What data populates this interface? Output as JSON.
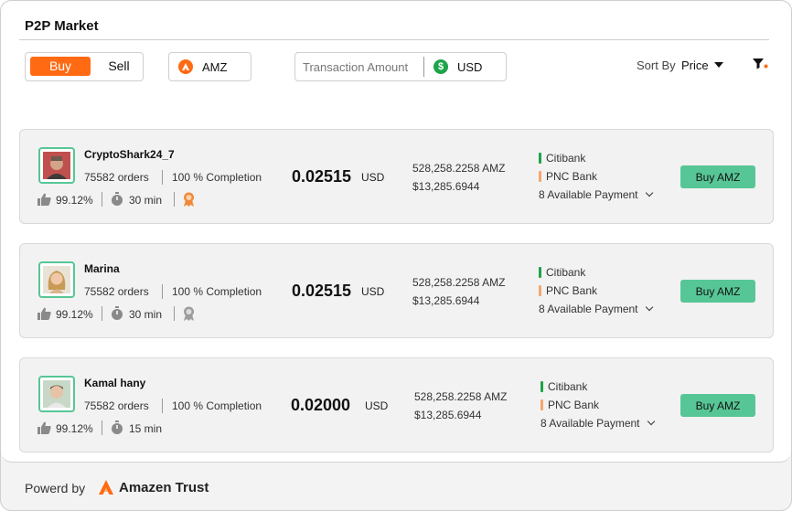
{
  "header": {
    "title": "P2P Market"
  },
  "toolbar": {
    "buy_label": "Buy",
    "sell_label": "Sell",
    "asset": "AMZ",
    "asset_icon": "amazen-logo-icon",
    "amount_placeholder": "Transaction Amount",
    "currency": "USD",
    "currency_icon": "dollar-icon",
    "sort_label": "Sort By",
    "sort_value": "Price",
    "filter_icon": "filter-icon"
  },
  "offers": [
    {
      "name": "CryptoShark24_7",
      "orders": "75582 orders",
      "completion": "100 % Completion",
      "rating": "99.12%",
      "time": "30 min",
      "badge": "gold-badge-icon",
      "price": "0.02515",
      "price_currency": "USD",
      "available": "528,258.2258 AMZ",
      "limit": "$13,285.6944",
      "payments": [
        "Citibank",
        "PNC Bank"
      ],
      "more_payments": "8 Available Payment",
      "button": "Buy AMZ"
    },
    {
      "name": "Marina",
      "orders": "75582 orders",
      "completion": "100 % Completion",
      "rating": "99.12%",
      "time": "30 min",
      "badge": "silver-badge-icon",
      "price": "0.02515",
      "price_currency": "USD",
      "available": "528,258.2258 AMZ",
      "limit": "$13,285.6944",
      "payments": [
        "Citibank",
        "PNC Bank"
      ],
      "more_payments": "8 Available Payment",
      "button": "Buy AMZ"
    },
    {
      "name": "Kamal hany",
      "orders": "75582 orders",
      "completion": "100 % Completion",
      "rating": "99.12%",
      "time": "15 min",
      "price": "0.02000",
      "price_currency": "USD",
      "available": "528,258.2258 AMZ",
      "limit": "$13,285.6944",
      "payments": [
        "Citibank",
        "PNC Bank"
      ],
      "more_payments": "8 Available Payment",
      "button": "Buy AMZ"
    }
  ],
  "footer": {
    "label": "Powerd by",
    "brand": "Amazen Trust"
  },
  "colors": {
    "accent": "#ff6a13",
    "buy_button": "#57c696",
    "citibank_bar": "#1ea44a",
    "pnc_bar": "#f5a66d"
  }
}
